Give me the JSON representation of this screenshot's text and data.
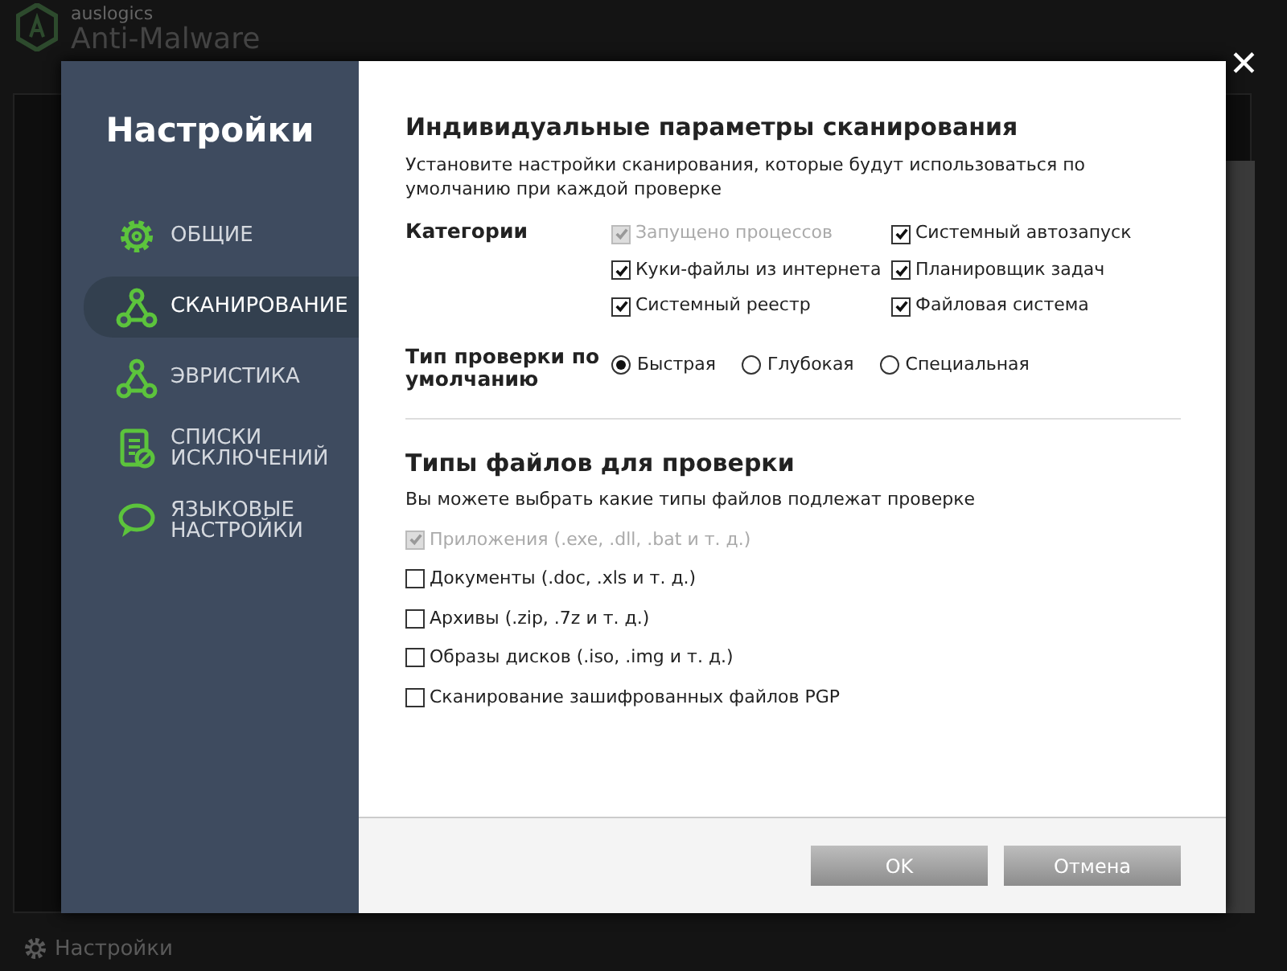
{
  "app": {
    "brand": "auslogics",
    "title": "Anti-Malware",
    "footer_link": "Настройки"
  },
  "dialog": {
    "title": "Настройки",
    "nav": [
      {
        "label": "ОБЩИЕ",
        "kind": "gear",
        "selected": false
      },
      {
        "label": "СКАНИРОВАНИЕ",
        "kind": "nodes",
        "selected": true
      },
      {
        "label": "ЭВРИСТИКА",
        "kind": "nodes",
        "selected": false
      },
      {
        "label": "СПИСКИ ИСКЛЮЧЕНИЙ",
        "kind": "list",
        "selected": false
      },
      {
        "label": "ЯЗЫКОВЫЕ НАСТРОЙКИ",
        "kind": "chat",
        "selected": false
      }
    ],
    "close_symbol": "✕",
    "heading": "Индивидуальные параметры сканирования",
    "description": "Установите настройки сканирования, которые будут использоваться по умолчанию при каждой проверке",
    "categories_label": "Категории",
    "categories": [
      {
        "label": "Запущено процессов",
        "checked": true,
        "disabled": true
      },
      {
        "label": "Системный автозапуск",
        "checked": true,
        "disabled": false
      },
      {
        "label": "Куки-файлы из интернета",
        "checked": true,
        "disabled": false
      },
      {
        "label": "Планировщик задач",
        "checked": true,
        "disabled": false
      },
      {
        "label": "Системный реестр",
        "checked": true,
        "disabled": false
      },
      {
        "label": "Файловая система",
        "checked": true,
        "disabled": false
      }
    ],
    "scan_type_label": "Тип проверки по умолчанию",
    "scan_types": [
      {
        "label": "Быстрая",
        "selected": true
      },
      {
        "label": "Глубокая",
        "selected": false
      },
      {
        "label": "Специальная",
        "selected": false
      }
    ],
    "file_types_heading": "Типы файлов для проверки",
    "file_types_description": "Вы можете выбрать какие типы файлов подлежат проверке",
    "file_types": [
      {
        "label": "Приложения (.exe, .dll, .bat и т. д.)",
        "checked": true,
        "disabled": true
      },
      {
        "label": "Документы (.doc, .xls и т. д.)",
        "checked": false,
        "disabled": false
      },
      {
        "label": "Архивы (.zip, .7z и т. д.)",
        "checked": false,
        "disabled": false
      },
      {
        "label": "Образы дисков (.iso, .img и т. д.)",
        "checked": false,
        "disabled": false
      },
      {
        "label": "Сканирование зашифрованных файлов PGP",
        "checked": false,
        "disabled": false
      }
    ],
    "buttons": [
      {
        "label": "OK"
      },
      {
        "label": "Отмена"
      }
    ]
  }
}
